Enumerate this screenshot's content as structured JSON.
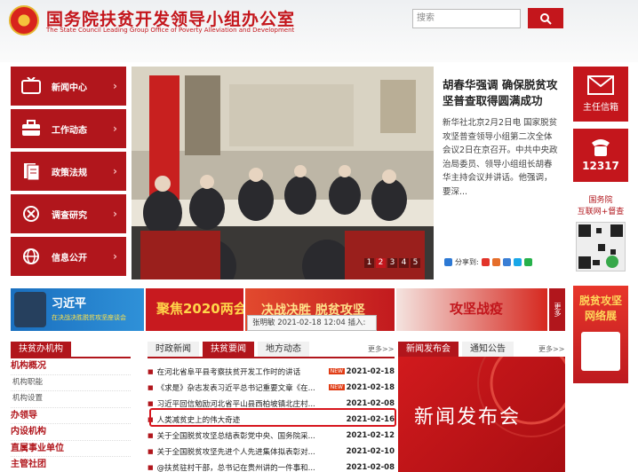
{
  "site": {
    "title": "国务院扶贫开发领导小组办公室",
    "subtitle": "The State Council Leading Group Office of Poverty Alleviation and Development"
  },
  "search": {
    "placeholder": "搜索"
  },
  "nav": [
    {
      "label": "新闻中心",
      "icon": "tv-icon"
    },
    {
      "label": "工作动态",
      "icon": "briefcase-icon"
    },
    {
      "label": "政策法规",
      "icon": "document-icon"
    },
    {
      "label": "调查研究",
      "icon": "research-icon"
    },
    {
      "label": "信息公开",
      "icon": "globe-icon"
    }
  ],
  "headline": {
    "title": "胡春华强调 确保脱贫攻坚普查取得圆满成功",
    "summary": "新华社北京2月2日电 国家脱贫攻坚普查领导小组第二次全体会议2日在京召开。中共中央政治局委员、领导小组组长胡春华主持会议并讲话。他强调，要深..."
  },
  "slider": {
    "pages": [
      "1",
      "2",
      "3",
      "4",
      "5"
    ],
    "active": "2"
  },
  "share": {
    "label": "分享到:"
  },
  "right": {
    "mailbox": "主任信箱",
    "hotline": "12317",
    "app_line1": "国务院",
    "app_line2": "互联网+督查",
    "app_badge": "国务院",
    "poster_line1": "脱贫攻坚",
    "poster_line2": "网络展"
  },
  "banners": {
    "b1_title": "习近平",
    "b1_sub": "在决战决胜脱贫攻坚座谈会",
    "b2_title": "聚焦2020两会",
    "b3_title": "决战决胜 脱贫攻坚",
    "b4_title": "攻坚战疫",
    "more": "更多"
  },
  "tooltip": {
    "text": "张明敏 2021-02-18 12:04 插入:"
  },
  "left": {
    "tab": "扶贫办机构",
    "items": [
      {
        "text": "机构概况",
        "kind": "h"
      },
      {
        "text": "机构职能",
        "kind": "s"
      },
      {
        "text": "机构设置",
        "kind": "s"
      },
      {
        "text": "办领导",
        "kind": "h"
      },
      {
        "text": "内设机构",
        "kind": "h"
      },
      {
        "text": "直属事业单位",
        "kind": "h"
      },
      {
        "text": "主管社团",
        "kind": "h"
      }
    ]
  },
  "mid": {
    "tabs": [
      "时政新闻",
      "扶贫要闻",
      "地方动态"
    ],
    "more": "更多>>",
    "rows": [
      {
        "title": "在河北省阜平县考察扶贫开发工作时的讲话",
        "date": "2021-02-18",
        "hot": "NEW"
      },
      {
        "title": "《求是》杂志发表习近平总书记重要文章《在...",
        "date": "2021-02-18",
        "hot": "NEW"
      },
      {
        "title": "习近平回信勉励河北省平山县西柏坡镇北庄村...",
        "date": "2021-02-08",
        "hot": ""
      },
      {
        "title": "人类减贫史上的伟大奇迹",
        "date": "2021-02-16",
        "hot": ""
      },
      {
        "title": "关于全国脱贫攻坚总结表彰党中央、国务院采...",
        "date": "2021-02-12",
        "hot": ""
      },
      {
        "title": "关于全国脱贫攻坚先进个人先进集体拟表彰对...",
        "date": "2021-02-10",
        "hot": ""
      },
      {
        "title": "@扶贫驻村干部，总书记在贵州讲的一件事和...",
        "date": "2021-02-08",
        "hot": ""
      }
    ]
  },
  "press": {
    "tabs": [
      "新闻发布会",
      "通知公告"
    ],
    "more": "更多>>",
    "title": "新闻发布会"
  }
}
